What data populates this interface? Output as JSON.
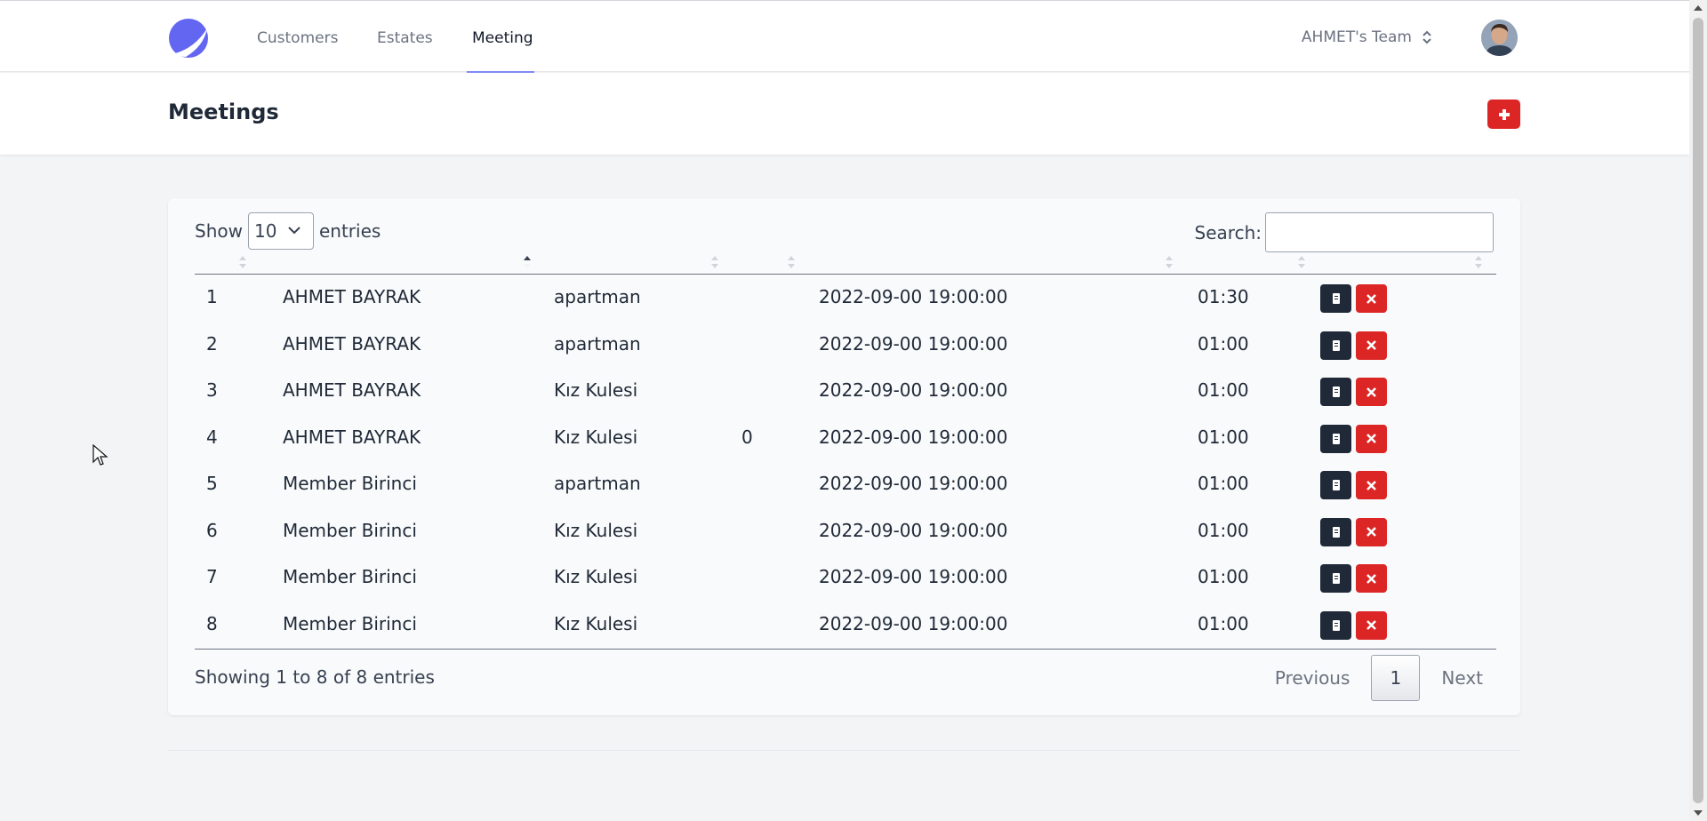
{
  "nav": {
    "items": [
      {
        "label": "Customers"
      },
      {
        "label": "Estates"
      },
      {
        "label": "Meeting"
      }
    ],
    "active": "Meeting",
    "team": "AHMET's Team"
  },
  "header": {
    "title": "Meetings",
    "add_icon": "plus-icon"
  },
  "table_controls": {
    "show_label": "Show",
    "page_size": "10",
    "entries_label": "entries",
    "search_label": "Search:",
    "search_value": ""
  },
  "rows": [
    {
      "id": "1",
      "name": "AHMET BAYRAK",
      "estate": "apartman",
      "extra": "",
      "date": "2022-09-00 19:00:00",
      "duration": "01:30"
    },
    {
      "id": "2",
      "name": "AHMET BAYRAK",
      "estate": "apartman",
      "extra": "",
      "date": "2022-09-00 19:00:00",
      "duration": "01:00"
    },
    {
      "id": "3",
      "name": "AHMET BAYRAK",
      "estate": "Kız Kulesi",
      "extra": "",
      "date": "2022-09-00 19:00:00",
      "duration": "01:00"
    },
    {
      "id": "4",
      "name": "AHMET BAYRAK",
      "estate": "Kız Kulesi",
      "extra": "0",
      "date": "2022-09-00 19:00:00",
      "duration": "01:00"
    },
    {
      "id": "5",
      "name": "Member Birinci",
      "estate": "apartman",
      "extra": "",
      "date": "2022-09-00 19:00:00",
      "duration": "01:00"
    },
    {
      "id": "6",
      "name": "Member Birinci",
      "estate": "Kız Kulesi",
      "extra": "",
      "date": "2022-09-00 19:00:00",
      "duration": "01:00"
    },
    {
      "id": "7",
      "name": "Member Birinci",
      "estate": "Kız Kulesi",
      "extra": "",
      "date": "2022-09-00 19:00:00",
      "duration": "01:00"
    },
    {
      "id": "8",
      "name": "Member Birinci",
      "estate": "Kız Kulesi",
      "extra": "",
      "date": "2022-09-00 19:00:00",
      "duration": "01:00"
    }
  ],
  "footer": {
    "info": "Showing 1 to 8 of 8 entries",
    "previous": "Previous",
    "current_page": "1",
    "next": "Next"
  },
  "colors": {
    "accent": "#818cf8",
    "danger": "#dc2626",
    "dark": "#1f2937"
  }
}
